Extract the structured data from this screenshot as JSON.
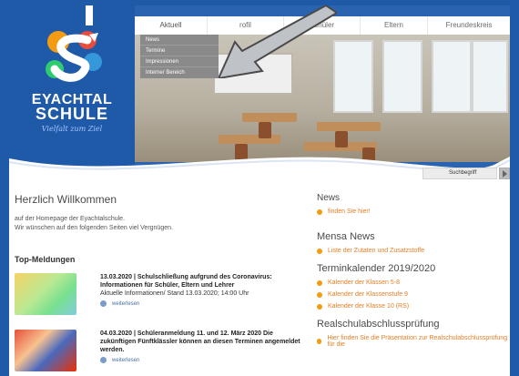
{
  "nav": {
    "items": [
      "Aktuell",
      "rofil",
      "Schüler",
      "Eltern",
      "Freundeskreis"
    ],
    "active_index": 0
  },
  "dropdown": {
    "items": [
      "News",
      "Termine",
      "Impressionen",
      "Interner Bereich"
    ]
  },
  "logo": {
    "line1": "EYACHTAL",
    "line2": "SCHULE",
    "slogan": "Vielfalt zum Ziel"
  },
  "search": {
    "placeholder": "Suchbegriff"
  },
  "welcome": {
    "title": "Herzlich Willkommen",
    "line1": "auf der Homepage der Eyachtalschule.",
    "line2": "Wir wünschen auf den folgenden Seiten viel Vergnügen."
  },
  "top_news": {
    "heading": "Top-Meldungen",
    "items": [
      {
        "title": "13.03.2020  |  Schulschließung aufgrund des Coronavirus: Informationen für Schüler, Eltern und Lehrer",
        "subtitle": "Aktuelle Informationen/ Stand 13.03.2020; 14:00 Uhr",
        "more": "weiterlesen"
      },
      {
        "title": "04.03.2020  |  Schüleranmeldung 11. und 12. März 2020 Die zukünftigen Fünftklässler können an diesen Terminen angemeldet werden.",
        "subtitle": "",
        "more": "weiterlesen"
      }
    ]
  },
  "sidebar": {
    "news_heading": "News",
    "news_link": "finden Sie hier!",
    "mensa_heading": "Mensa News",
    "mensa_link": "Liste der Zutaten und Zusatzstoffe",
    "termine_heading": "Terminkalender 2019/2020",
    "termine_links": [
      "Kalender der Klassen 5-8",
      "Kalender der Klassenstufe 9",
      "Kalender der Klasse 10 (RS)"
    ],
    "realschul_heading": "Realschulabschlussprüfung",
    "realschul_link": "Hier finden Sie die Präsentation zur Realschulabschlussprüfung für die"
  },
  "colors": {
    "brand_blue": "#1f5aa8",
    "link_orange": "#e67e22"
  }
}
